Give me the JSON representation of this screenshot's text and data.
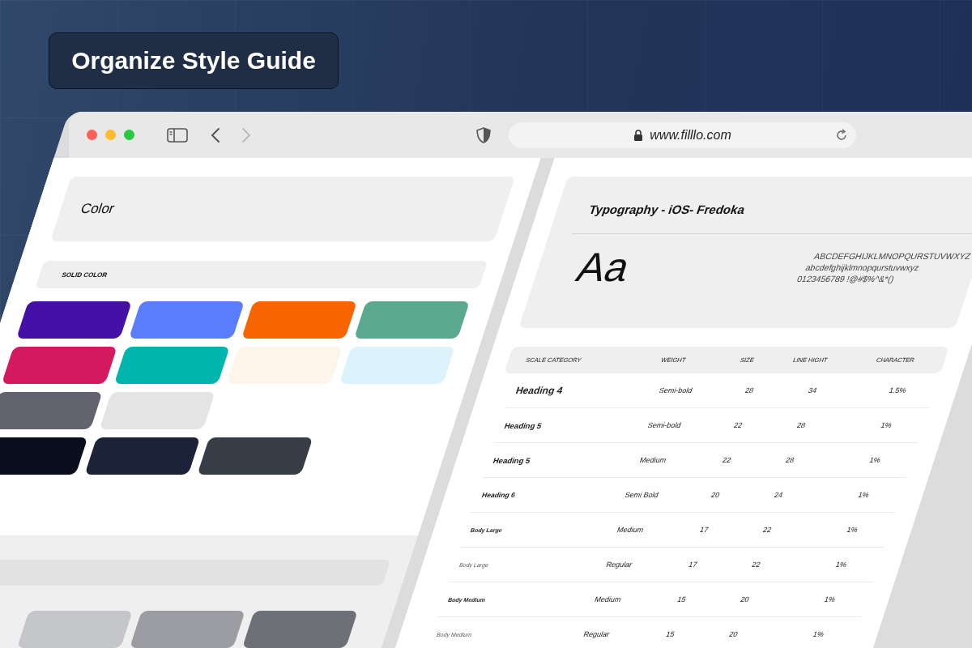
{
  "badge": {
    "title": "Organize Style Guide"
  },
  "browser": {
    "url": "www.filllo.com"
  },
  "color_panel": {
    "title": "Color",
    "section": "SOLID COLOR",
    "swatch_rows": [
      [
        {
          "color": "#4410a5"
        },
        {
          "color": "#5a7dfe"
        },
        {
          "color": "#f76400"
        },
        {
          "color": "#5aa98f"
        }
      ],
      [
        {
          "color": "#d4195e"
        },
        {
          "color": "#00b5ad"
        },
        {
          "color": "#fdf4ea"
        },
        {
          "color": "#dcf3fc"
        }
      ],
      [
        {
          "color": "#62636f"
        },
        {
          "color": "#e4e4e4"
        }
      ],
      [
        {
          "color": "#0a0f1e"
        },
        {
          "color": "#1c2338"
        },
        {
          "color": "#383c46"
        }
      ]
    ],
    "lower_swatches": [
      {
        "color": "#c5c6c9"
      },
      {
        "color": "#9b9da2"
      },
      {
        "color": "#6e7078"
      }
    ]
  },
  "typography_panel": {
    "title": "Typography - iOS- Fredoka",
    "sample": "Aa",
    "charsets": [
      "ABCDEFGHIJKLMNOPQURSTUVWXYZ",
      "abcdefghijklmnopqurstuvwxyz",
      "0123456789 !@#$%^&*()"
    ],
    "table": {
      "columns": [
        "SCALE CATEGORY",
        "WEIGHT",
        "SIZE",
        "LINE HIGHT",
        "CHARACTER"
      ],
      "rows": [
        {
          "kind": "h4",
          "cells": [
            "Heading 4",
            "Semi-bold",
            "28",
            "34",
            "1.5%"
          ]
        },
        {
          "kind": "h5",
          "cells": [
            "Heading 5",
            "Semi-bold",
            "22",
            "28",
            "1%"
          ]
        },
        {
          "kind": "h5",
          "cells": [
            "Heading 5",
            "Medium",
            "22",
            "28",
            "1%"
          ]
        },
        {
          "kind": "h6",
          "cells": [
            "Heading 6",
            "Semi Bold",
            "20",
            "24",
            "1%"
          ]
        },
        {
          "kind": "body-strong",
          "cells": [
            "Body Large",
            "Medium",
            "17",
            "22",
            "1%"
          ]
        },
        {
          "kind": "body",
          "cells": [
            "Body Large",
            "Regular",
            "17",
            "22",
            "1%"
          ]
        },
        {
          "kind": "body-strong",
          "cells": [
            "Body Medium",
            "Medium",
            "15",
            "20",
            "1%"
          ]
        },
        {
          "kind": "body",
          "cells": [
            "Body Medium",
            "Regular",
            "15",
            "20",
            "1%"
          ]
        }
      ]
    }
  }
}
